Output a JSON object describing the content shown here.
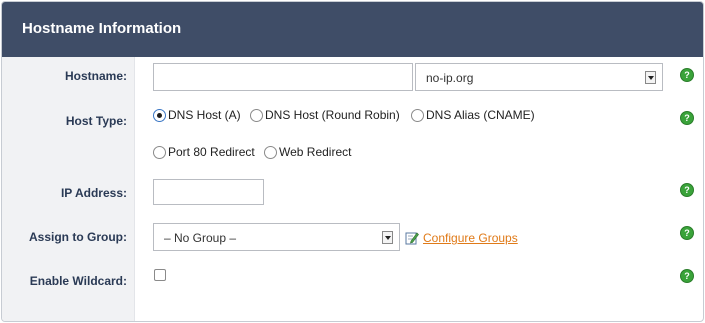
{
  "header": {
    "title": "Hostname Information"
  },
  "form": {
    "hostname": {
      "label": "Hostname:",
      "value": "",
      "domain_selected": "no-ip.org"
    },
    "host_type": {
      "label": "Host Type:",
      "options": [
        "DNS Host (A)",
        "DNS Host (Round Robin)",
        "DNS Alias (CNAME)",
        "Port 80 Redirect",
        "Web Redirect"
      ],
      "selected": "DNS Host (A)"
    },
    "ip_address": {
      "label": "IP Address:",
      "value": ""
    },
    "group": {
      "label": "Assign to Group:",
      "selected": "– No Group –",
      "configure_link": "Configure Groups"
    },
    "wildcard": {
      "label": "Enable Wildcard:",
      "checked": false
    }
  },
  "help_icon_glyph": "?",
  "colors": {
    "header_bg": "#3f4d67",
    "label_text": "#2a3a55",
    "link": "#e07a18",
    "help_green": "#3aa33a"
  }
}
